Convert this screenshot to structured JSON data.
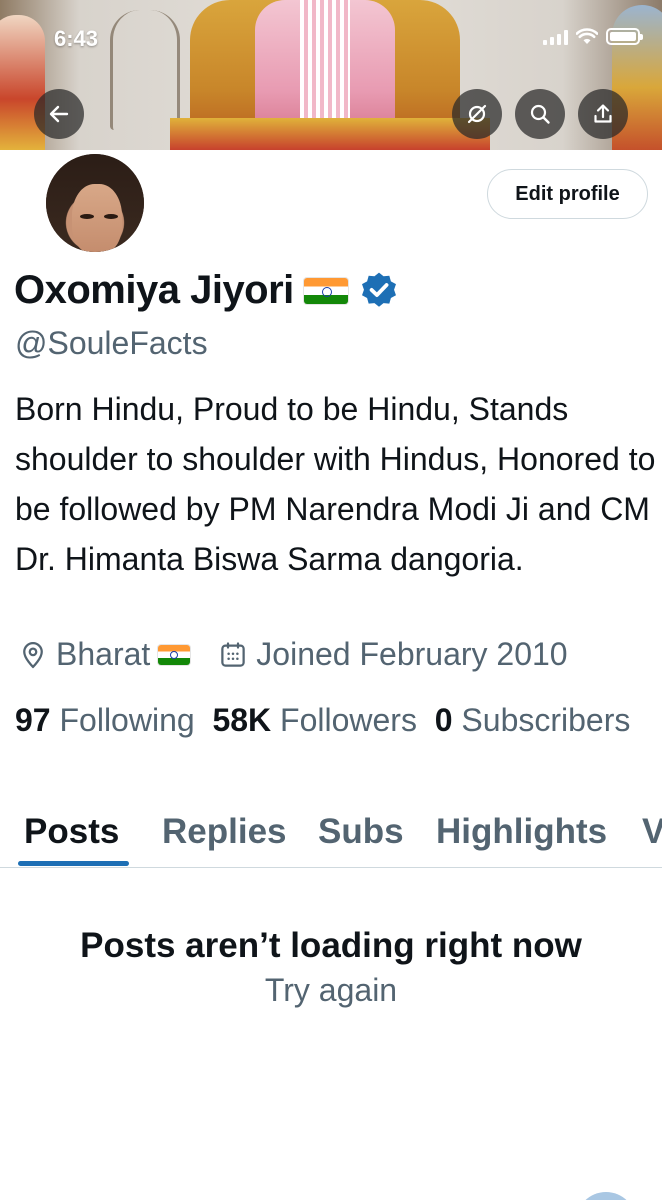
{
  "status_bar": {
    "time": "6:43"
  },
  "banner": {
    "back_icon": "arrow-left-icon",
    "actions": [
      "hide-icon",
      "search-icon",
      "share-icon"
    ]
  },
  "profile": {
    "display_name": "Oxomiya Jiyori",
    "flag": "india-flag",
    "verified_icon": "verified-badge-icon",
    "handle": "@SouleFacts",
    "edit_button": "Edit profile",
    "bio": "Born Hindu, Proud to be Hindu, Stands shoulder to shoulder with Hindus, Honored to be followed by PM Narendra Modi Ji and CM Dr. Himanta Biswa Sarma dangoria.",
    "location": "Bharat",
    "joined": "Joined February 2010"
  },
  "stats": {
    "following_count": "97",
    "following_label": "Following",
    "followers_count": "58K",
    "followers_label": "Followers",
    "subscribers_count": "0",
    "subscribers_label": "Subscribers"
  },
  "tabs": [
    {
      "label": "Posts",
      "active": true
    },
    {
      "label": "Replies",
      "active": false
    },
    {
      "label": "Subs",
      "active": false
    },
    {
      "label": "Highlights",
      "active": false
    },
    {
      "label": "V",
      "active": false
    }
  ],
  "empty_state": {
    "title": "Posts aren’t loading right now",
    "retry": "Try again"
  },
  "colors": {
    "text_primary": "#0f1419",
    "text_secondary": "#536471",
    "verified": "#1d6fb5",
    "border": "#cfd9de"
  }
}
